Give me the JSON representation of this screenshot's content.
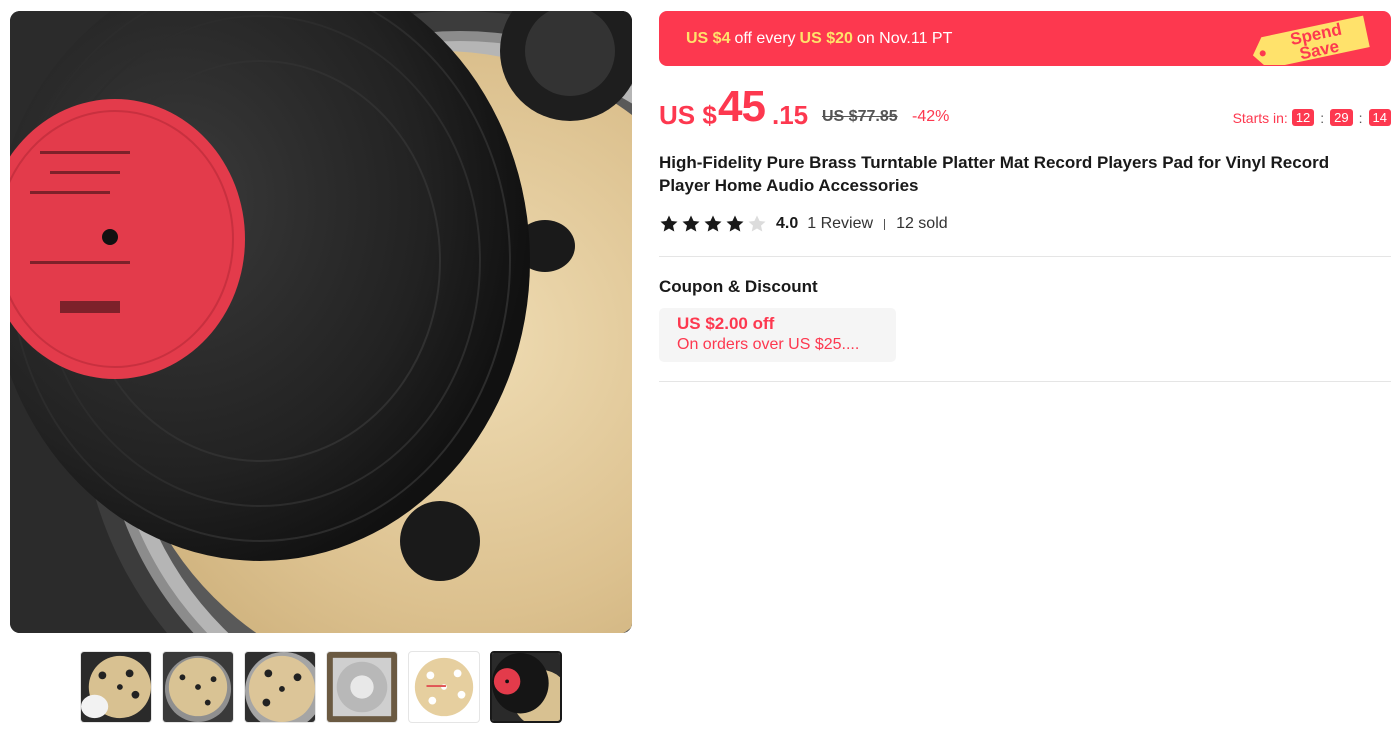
{
  "gallery": {
    "main_image_label": "",
    "thumbnails": [
      {
        "name": "thumb-glove-mat"
      },
      {
        "name": "thumb-mat-turntable"
      },
      {
        "name": "thumb-mat-closeup"
      },
      {
        "name": "thumb-mat-package"
      },
      {
        "name": "thumb-mat-flat"
      },
      {
        "name": "thumb-record-on-mat"
      }
    ],
    "active_index": 5
  },
  "promo": {
    "amount": "US $4",
    "text": "off every",
    "threshold": "US $20",
    "date": "on Nov.11 PT",
    "badge_line1": "Spend",
    "badge_line2": "Save"
  },
  "price": {
    "currency": "US $",
    "integer": "45",
    "decimal": ".15",
    "original": "US $77.85",
    "discount": "-42%"
  },
  "countdown": {
    "label": "Starts in:",
    "hours": "12",
    "minutes": "29",
    "seconds": "14",
    "separator": ":"
  },
  "product": {
    "title": "High-Fidelity Pure Brass Turntable Platter Mat Record Players Pad for Vinyl Record Player Home Audio Accessories",
    "rating": "4.0",
    "rating_stars": 4,
    "reviews": "1 Review",
    "sold": "12 sold"
  },
  "coupon": {
    "heading": "Coupon & Discount",
    "amount": "US $2.00 off",
    "condition": "On orders over US $25...."
  },
  "colors": {
    "accent": "#fd384f",
    "highlight": "#ffe26b",
    "badge": "#ffe26b"
  }
}
